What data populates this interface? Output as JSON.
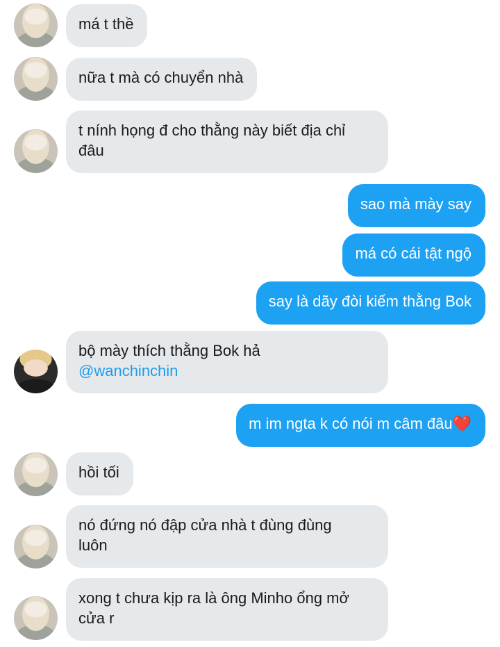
{
  "messages": [
    {
      "side": "in",
      "lines": [
        "má t thề"
      ]
    },
    {
      "side": "in",
      "lines": [
        "nữa t mà có chuyển nhà"
      ]
    },
    {
      "side": "in",
      "lines": [
        "t nính họng đ cho thằng này biết địa chỉ",
        "đâu"
      ]
    },
    {
      "side": "out",
      "lines": [
        "sao mà mày say"
      ]
    },
    {
      "side": "out",
      "lines": [
        "má có cái tật ngộ"
      ]
    },
    {
      "side": "out",
      "lines": [
        "say là dãy đòi kiếm thằng Bok"
      ]
    },
    {
      "side": "in",
      "lines": [
        "bộ mày thích thằng Bok hả"
      ],
      "mention": "@wanchinchin"
    },
    {
      "side": "out",
      "lines": [
        "m im ngta k có nói m câm đâu"
      ],
      "emoji": "❤️"
    },
    {
      "side": "in",
      "lines": [
        "hồi tối"
      ]
    },
    {
      "side": "in",
      "lines": [
        "nó đứng nó đập cửa nhà t đùng đùng",
        "luôn"
      ]
    },
    {
      "side": "in",
      "lines": [
        "xong t chưa kịp ra là ông Minho ổng mở",
        "cửa r"
      ]
    }
  ]
}
